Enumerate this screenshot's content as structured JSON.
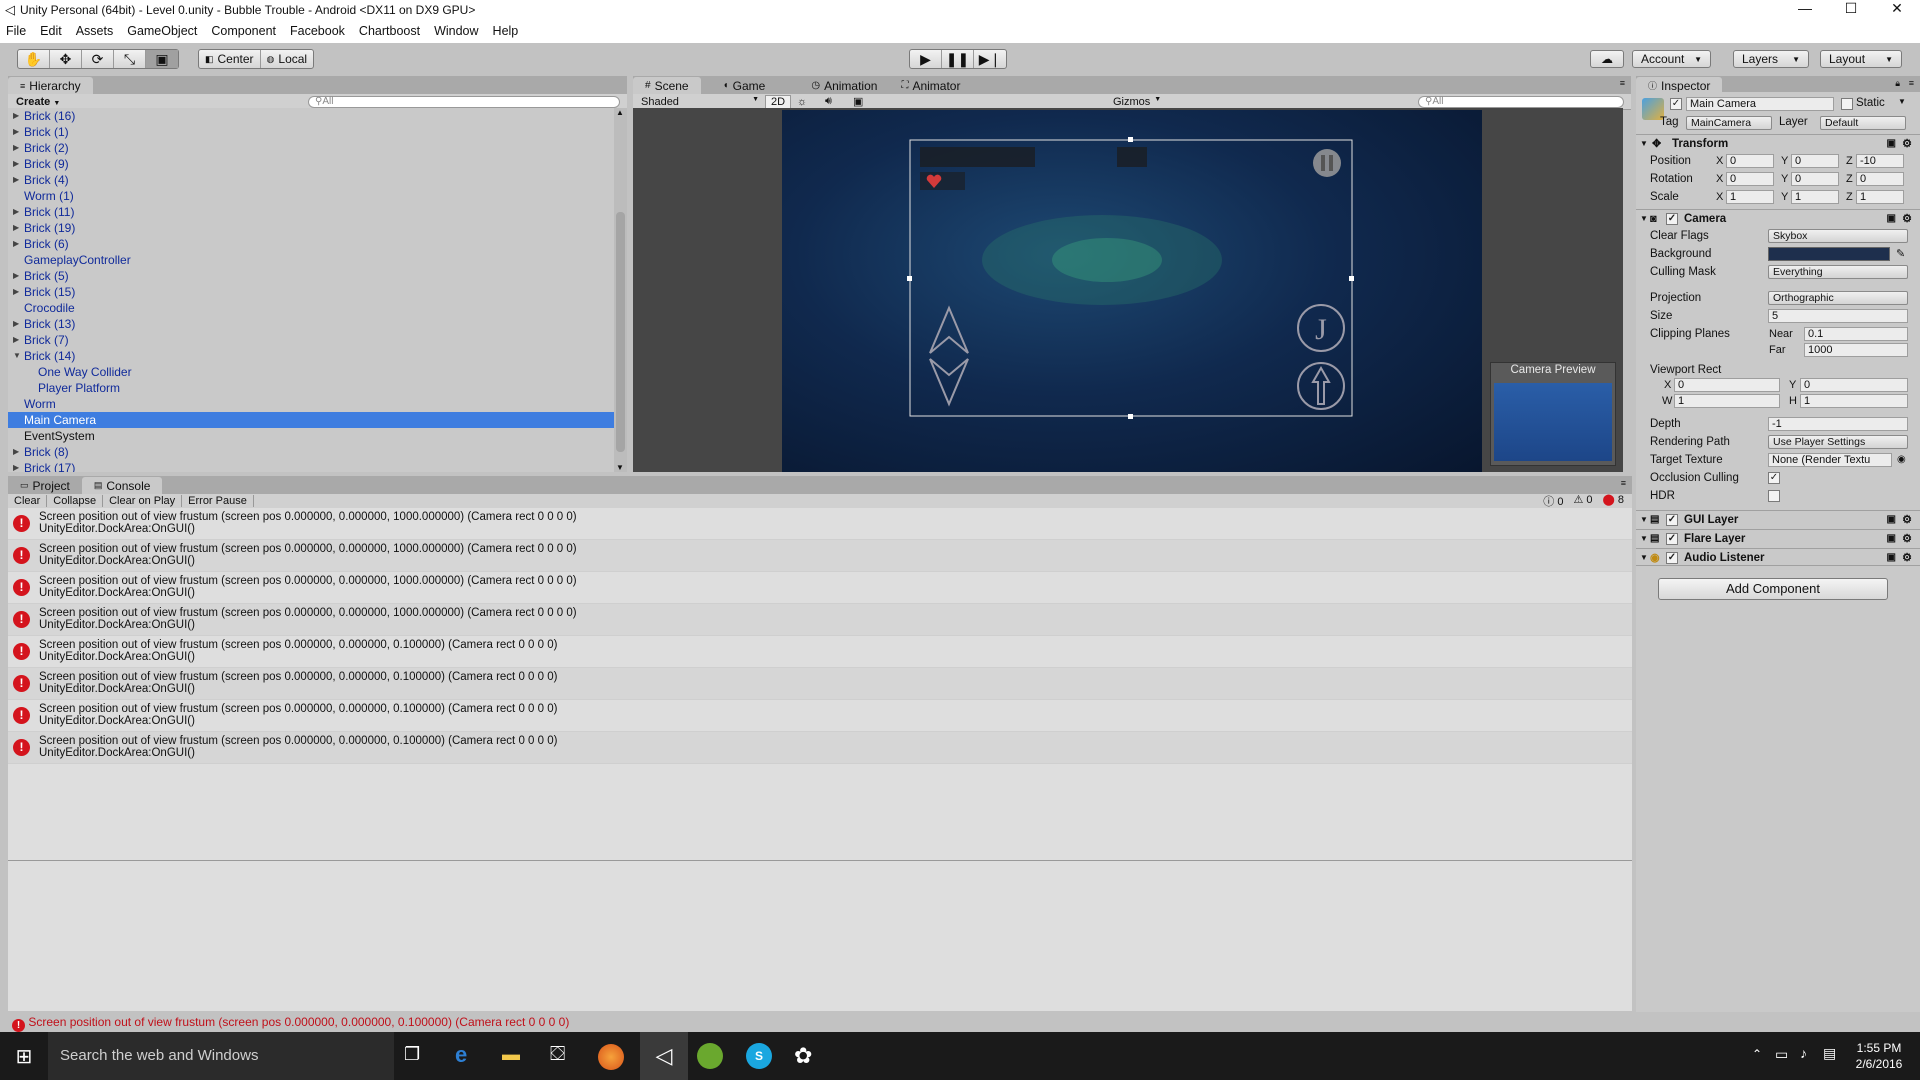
{
  "window": {
    "title": "Unity Personal (64bit) - Level 0.unity - Bubble Trouble - Android <DX11 on DX9 GPU>",
    "minimize": "—",
    "maximize": "☐",
    "close": "✕"
  },
  "menu": [
    "File",
    "Edit",
    "Assets",
    "GameObject",
    "Component",
    "Facebook",
    "Chartboost",
    "Window",
    "Help"
  ],
  "toolbar": {
    "pivot": "Center",
    "space": "Local",
    "account": "Account",
    "layers": "Layers",
    "layout": "Layout"
  },
  "hierarchy": {
    "tab": "Hierarchy",
    "create": "Create",
    "search_placeholder": "All",
    "items": [
      {
        "label": "Brick (16)",
        "arrow": "▶",
        "indent": 0,
        "style": "blue"
      },
      {
        "label": "Brick (1)",
        "arrow": "▶",
        "indent": 0,
        "style": "blue"
      },
      {
        "label": "Brick (2)",
        "arrow": "▶",
        "indent": 0,
        "style": "blue"
      },
      {
        "label": "Brick (9)",
        "arrow": "▶",
        "indent": 0,
        "style": "blue"
      },
      {
        "label": "Brick (4)",
        "arrow": "▶",
        "indent": 0,
        "style": "blue"
      },
      {
        "label": "Worm (1)",
        "arrow": "",
        "indent": 0,
        "style": "blue"
      },
      {
        "label": "Brick (11)",
        "arrow": "▶",
        "indent": 0,
        "style": "blue"
      },
      {
        "label": "Brick (19)",
        "arrow": "▶",
        "indent": 0,
        "style": "blue"
      },
      {
        "label": "Brick (6)",
        "arrow": "▶",
        "indent": 0,
        "style": "blue"
      },
      {
        "label": "GameplayController",
        "arrow": "",
        "indent": 0,
        "style": "blue"
      },
      {
        "label": "Brick (5)",
        "arrow": "▶",
        "indent": 0,
        "style": "blue"
      },
      {
        "label": "Brick (15)",
        "arrow": "▶",
        "indent": 0,
        "style": "blue"
      },
      {
        "label": "Crocodile",
        "arrow": "",
        "indent": 0,
        "style": "blue"
      },
      {
        "label": "Brick (13)",
        "arrow": "▶",
        "indent": 0,
        "style": "blue"
      },
      {
        "label": "Brick (7)",
        "arrow": "▶",
        "indent": 0,
        "style": "blue"
      },
      {
        "label": "Brick (14)",
        "arrow": "▼",
        "indent": 0,
        "style": "blue"
      },
      {
        "label": "One Way Collider",
        "arrow": "",
        "indent": 1,
        "style": "blue"
      },
      {
        "label": "Player Platform",
        "arrow": "",
        "indent": 1,
        "style": "blue"
      },
      {
        "label": "Worm",
        "arrow": "",
        "indent": 0,
        "style": "blue"
      },
      {
        "label": "Main Camera",
        "arrow": "",
        "indent": 0,
        "style": "selected"
      },
      {
        "label": "EventSystem",
        "arrow": "",
        "indent": 0,
        "style": "black"
      },
      {
        "label": "Brick (8)",
        "arrow": "▶",
        "indent": 0,
        "style": "blue"
      },
      {
        "label": "Brick (17)",
        "arrow": "▶",
        "indent": 0,
        "style": "blue"
      }
    ]
  },
  "scene": {
    "tabs": [
      "Scene",
      "Game",
      "Animation",
      "Animator"
    ],
    "shading": "Shaded",
    "mode_2d": "2D",
    "gizmos": "Gizmos",
    "search_placeholder": "All",
    "camera_preview_label": "Camera Preview",
    "jump_glyph": "J"
  },
  "console": {
    "tabs": [
      "Project",
      "Console"
    ],
    "buttons": [
      "Clear",
      "Collapse",
      "Clear on Play",
      "Error Pause"
    ],
    "info_count": "0",
    "warn_count": "0",
    "error_count": "8",
    "entries": [
      {
        "line1": "Screen position out of view frustum (screen pos 0.000000, 0.000000, 1000.000000) (Camera rect 0 0 0 0)",
        "line2": "UnityEditor.DockArea:OnGUI()"
      },
      {
        "line1": "Screen position out of view frustum (screen pos 0.000000, 0.000000, 1000.000000) (Camera rect 0 0 0 0)",
        "line2": "UnityEditor.DockArea:OnGUI()"
      },
      {
        "line1": "Screen position out of view frustum (screen pos 0.000000, 0.000000, 1000.000000) (Camera rect 0 0 0 0)",
        "line2": "UnityEditor.DockArea:OnGUI()"
      },
      {
        "line1": "Screen position out of view frustum (screen pos 0.000000, 0.000000, 1000.000000) (Camera rect 0 0 0 0)",
        "line2": "UnityEditor.DockArea:OnGUI()"
      },
      {
        "line1": "Screen position out of view frustum (screen pos 0.000000, 0.000000, 0.100000) (Camera rect 0 0 0 0)",
        "line2": "UnityEditor.DockArea:OnGUI()"
      },
      {
        "line1": "Screen position out of view frustum (screen pos 0.000000, 0.000000, 0.100000) (Camera rect 0 0 0 0)",
        "line2": "UnityEditor.DockArea:OnGUI()"
      },
      {
        "line1": "Screen position out of view frustum (screen pos 0.000000, 0.000000, 0.100000) (Camera rect 0 0 0 0)",
        "line2": "UnityEditor.DockArea:OnGUI()"
      },
      {
        "line1": "Screen position out of view frustum (screen pos 0.000000, 0.000000, 0.100000) (Camera rect 0 0 0 0)",
        "line2": "UnityEditor.DockArea:OnGUI()"
      }
    ],
    "error_glyph": "!"
  },
  "inspector": {
    "tab": "Inspector",
    "object_name": "Main Camera",
    "static_label": "Static",
    "tag_label": "Tag",
    "tag_value": "MainCamera",
    "layer_label": "Layer",
    "layer_value": "Default",
    "transform": {
      "title": "Transform",
      "position_label": "Position",
      "rotation_label": "Rotation",
      "scale_label": "Scale",
      "axis_x": "X",
      "axis_y": "Y",
      "axis_z": "Z",
      "position": [
        "0",
        "0",
        "-10"
      ],
      "rotation": [
        "0",
        "0",
        "0"
      ],
      "scale": [
        "1",
        "1",
        "1"
      ]
    },
    "camera": {
      "title": "Camera",
      "clear_flags_label": "Clear Flags",
      "clear_flags": "Skybox",
      "background_label": "Background",
      "background_color": "#1e2f4d",
      "culling_mask_label": "Culling Mask",
      "culling_mask": "Everything",
      "projection_label": "Projection",
      "projection": "Orthographic",
      "size_label": "Size",
      "size": "5",
      "clipping_label": "Clipping Planes",
      "near_label": "Near",
      "near": "0.1",
      "far_label": "Far",
      "far": "1000",
      "viewport_label": "Viewport Rect",
      "vp_x_label": "X",
      "vp_y_label": "Y",
      "vp_w_label": "W",
      "vp_h_label": "H",
      "vp_x": "0",
      "vp_y": "0",
      "vp_w": "1",
      "vp_h": "1",
      "depth_label": "Depth",
      "depth": "-1",
      "rendering_path_label": "Rendering Path",
      "rendering_path": "Use Player Settings",
      "target_texture_label": "Target Texture",
      "target_texture": "None (Render Textu",
      "occlusion_label": "Occlusion Culling",
      "hdr_label": "HDR"
    },
    "gui_layer": "GUI Layer",
    "flare_layer": "Flare Layer",
    "audio_listener": "Audio Listener",
    "add_component": "Add Component"
  },
  "status_bar": "Screen position out of view frustum (screen pos 0.000000, 0.000000, 0.100000) (Camera rect 0 0 0 0)",
  "taskbar": {
    "search_placeholder": "Search the web and Windows",
    "time": "1:55 PM",
    "date": "2/6/2016"
  },
  "colors": {
    "selection": "#3e7de0",
    "error": "#d4141d",
    "accent_blue": "#102a9a"
  }
}
